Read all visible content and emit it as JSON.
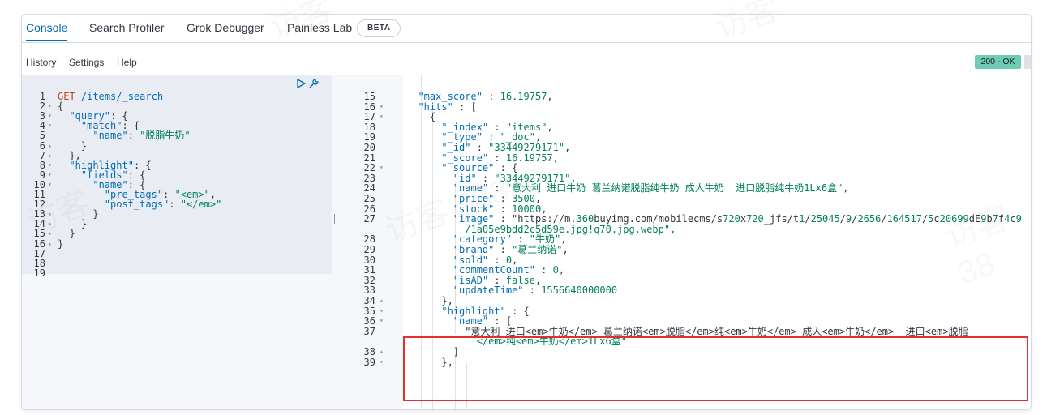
{
  "tabs": [
    {
      "label": "Console",
      "active": true
    },
    {
      "label": "Search Profiler"
    },
    {
      "label": "Grok Debugger"
    },
    {
      "label": "Painless Lab"
    }
  ],
  "beta_badge": "BETA",
  "menu": {
    "history": "History",
    "settings": "Settings",
    "help": "Help"
  },
  "status": {
    "label": "200 - OK",
    "color": "#6dccb1"
  },
  "request_lines": [
    {
      "n": "1",
      "fold": "",
      "t": "GET /items/_search"
    },
    {
      "n": "2",
      "fold": "▾",
      "t": "{"
    },
    {
      "n": "3",
      "fold": "▾",
      "t": "  \"query\": {"
    },
    {
      "n": "4",
      "fold": "▾",
      "t": "    \"match\": {"
    },
    {
      "n": "5",
      "fold": "",
      "t": "      \"name\": \"脱脂牛奶\""
    },
    {
      "n": "6",
      "fold": "▴",
      "t": "    }"
    },
    {
      "n": "7",
      "fold": "▴",
      "t": "  },"
    },
    {
      "n": "8",
      "fold": "▾",
      "t": "  \"highlight\": {"
    },
    {
      "n": "9",
      "fold": "▾",
      "t": "    \"fields\": {"
    },
    {
      "n": "10",
      "fold": "▾",
      "t": "      \"name\": {"
    },
    {
      "n": "11",
      "fold": "",
      "t": "        \"pre_tags\": \"<em>\","
    },
    {
      "n": "12",
      "fold": "",
      "t": "        \"post_tags\": \"</em>\""
    },
    {
      "n": "13",
      "fold": "▴",
      "t": "      }"
    },
    {
      "n": "14",
      "fold": "▴",
      "t": "    }"
    },
    {
      "n": "15",
      "fold": "▴",
      "t": "  }"
    },
    {
      "n": "16",
      "fold": "▴",
      "t": "}"
    },
    {
      "n": "17",
      "fold": "",
      "t": ""
    },
    {
      "n": "18",
      "fold": "",
      "t": ""
    },
    {
      "n": "19",
      "fold": "",
      "t": ""
    }
  ],
  "response_lines": [
    {
      "n": "15",
      "fold": "",
      "t": "  \"max_score\" : 16.19757,"
    },
    {
      "n": "16",
      "fold": "▾",
      "t": "  \"hits\" : ["
    },
    {
      "n": "17",
      "fold": "▾",
      "t": "    {"
    },
    {
      "n": "18",
      "fold": "",
      "t": "      \"_index\" : \"items\","
    },
    {
      "n": "19",
      "fold": "",
      "t": "      \"_type\" : \"_doc\","
    },
    {
      "n": "20",
      "fold": "",
      "t": "      \"_id\" : \"33449279171\","
    },
    {
      "n": "21",
      "fold": "",
      "t": "      \"_score\" : 16.19757,"
    },
    {
      "n": "22",
      "fold": "▾",
      "t": "      \"_source\" : {"
    },
    {
      "n": "23",
      "fold": "",
      "t": "        \"id\" : \"33449279171\","
    },
    {
      "n": "24",
      "fold": "",
      "t": "        \"name\" : \"意大利 进口牛奶 葛兰纳诺脱脂纯牛奶 成人牛奶  进口脱脂纯牛奶1Lx6盒\","
    },
    {
      "n": "25",
      "fold": "",
      "t": "        \"price\" : 3500,"
    },
    {
      "n": "26",
      "fold": "",
      "t": "        \"stock\" : 10000,"
    },
    {
      "n": "27",
      "fold": "",
      "t": "        \"image\" : \"https://m.360buyimg.com/mobilecms/s720x720_jfs/t1/25045/9/2656/164517/5c20699dE9b7f4c9"
    },
    {
      "n": "",
      "fold": "",
      "t": "          /1a05e9bdd2c5d59e.jpg!q70.jpg.webp\","
    },
    {
      "n": "28",
      "fold": "",
      "t": "        \"category\" : \"牛奶\","
    },
    {
      "n": "29",
      "fold": "",
      "t": "        \"brand\" : \"葛兰纳诺\","
    },
    {
      "n": "30",
      "fold": "",
      "t": "        \"sold\" : 0,"
    },
    {
      "n": "31",
      "fold": "",
      "t": "        \"commentCount\" : 0,"
    },
    {
      "n": "32",
      "fold": "",
      "t": "        \"isAD\" : false,"
    },
    {
      "n": "33",
      "fold": "",
      "t": "        \"updateTime\" : 1556640000000"
    },
    {
      "n": "34",
      "fold": "▴",
      "t": "      },"
    },
    {
      "n": "35",
      "fold": "▾",
      "t": "      \"highlight\" : {"
    },
    {
      "n": "36",
      "fold": "▾",
      "t": "        \"name\" : ["
    },
    {
      "n": "37",
      "fold": "",
      "t": "          \"意大利 进口<em>牛奶</em> 葛兰纳诺<em>脱脂</em>纯<em>牛奶</em> 成人<em>牛奶</em>  进口<em>脱脂"
    },
    {
      "n": "",
      "fold": "",
      "t": "            </em>纯<em>牛奶</em>1Lx6盒\""
    },
    {
      "n": "38",
      "fold": "▴",
      "t": "        ]"
    },
    {
      "n": "39",
      "fold": "▾",
      "t": "      },"
    }
  ]
}
